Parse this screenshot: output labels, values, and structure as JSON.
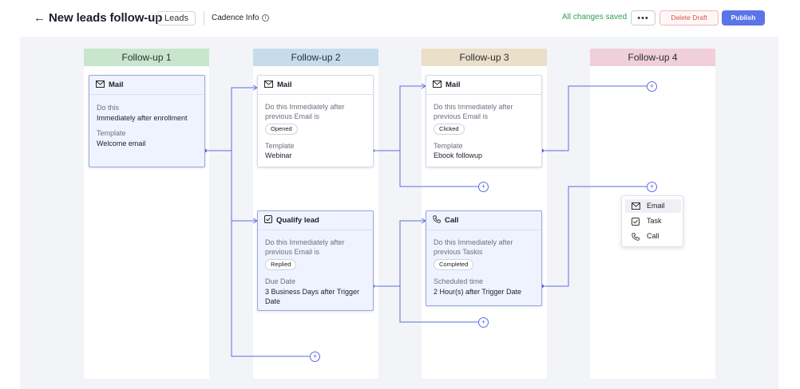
{
  "header": {
    "back_icon": "arrow-left-icon",
    "title": "New leads follow-up",
    "module_chip": "Leads",
    "cadence_info": "Cadence Info",
    "info_icon": "ⓘ",
    "status": "All changes saved",
    "more_label": "•••",
    "delete_label": "Delete Draft",
    "publish_label": "Publish"
  },
  "colors": {
    "accent": "#5b74e8",
    "connector": "#5b6be0",
    "saved": "#2f9e55",
    "delete": "#d9534f",
    "col1": "#c7e6cc",
    "col2": "#c6dced",
    "col3": "#eadfc8",
    "col4": "#f0cfda"
  },
  "columns": [
    {
      "label": "Follow-up 1"
    },
    {
      "label": "Follow-up 2"
    },
    {
      "label": "Follow-up 3"
    },
    {
      "label": "Follow-up 4"
    }
  ],
  "cards": {
    "c1_mail": {
      "title": "Mail",
      "icon": "mail-icon",
      "label1": "Do this",
      "value1": "Immediately after enrollment",
      "label2": "Template",
      "value2": "Welcome email"
    },
    "c2_mail": {
      "title": "Mail",
      "icon": "mail-icon",
      "condition_line1": "Do this Immediately after",
      "condition_line2": "previous Email is",
      "badge": "Opened",
      "label2": "Template",
      "value2": "Webinar"
    },
    "c2_qualify": {
      "title": "Qualify lead",
      "icon": "task-icon",
      "condition_line1": "Do this Immediately after",
      "condition_line2": "previous Email is",
      "badge": "Replied",
      "label2": "Due Date",
      "value2_line1": "3 Business Days after Trigger",
      "value2_line2": "Date"
    },
    "c3_mail": {
      "title": "Mail",
      "icon": "mail-icon",
      "condition_line1": "Do this Immediately after",
      "condition_line2": "previous Email is",
      "badge": "Clicked",
      "label2": "Template",
      "value2": "Ebook followup"
    },
    "c3_call": {
      "title": "Call",
      "icon": "phone-icon",
      "condition_line1": "Do this Immediately after",
      "condition_line2": "previous Taskis",
      "badge": "Completed",
      "label2": "Scheduled time",
      "value2": "2 Hour(s) after Trigger Date"
    }
  },
  "add_step_symbol": "+",
  "add_menu": {
    "items": [
      {
        "label": "Email",
        "icon": "mail-icon"
      },
      {
        "label": "Task",
        "icon": "task-icon"
      },
      {
        "label": "Call",
        "icon": "phone-icon"
      }
    ]
  }
}
